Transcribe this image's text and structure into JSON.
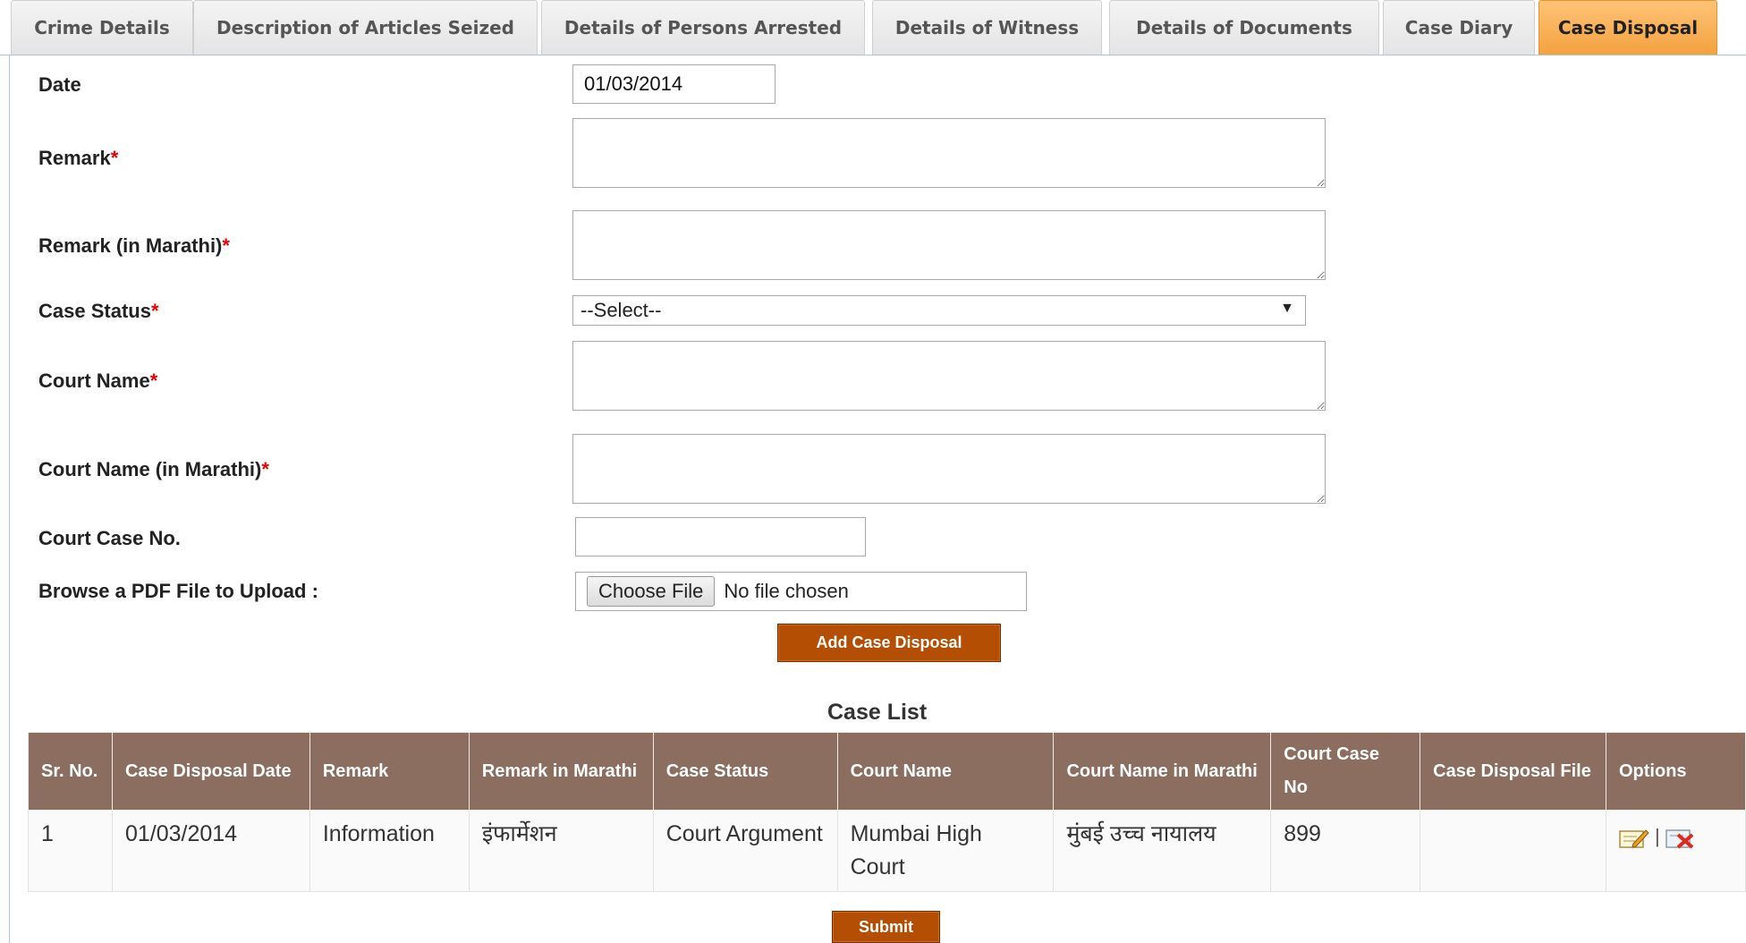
{
  "tabs": [
    {
      "label": "Crime Details",
      "active": false
    },
    {
      "label": "Description of Articles Seized",
      "active": false
    },
    {
      "label": "Details of Persons Arrested",
      "active": false
    },
    {
      "label": "Details of Witness",
      "active": false
    },
    {
      "label": "Details of Documents",
      "active": false
    },
    {
      "label": "Case Diary",
      "active": false
    },
    {
      "label": "Case Disposal",
      "active": true
    }
  ],
  "form": {
    "date_label": "Date",
    "date_value": "01/03/2014",
    "remark_label": "Remark",
    "remark_marathi_label": "Remark (in Marathi)",
    "case_status_label": "Case Status",
    "case_status_selected": "--Select--",
    "court_name_label": "Court Name",
    "court_name_marathi_label": "Court Name (in Marathi)",
    "court_case_no_label": "Court Case No.",
    "court_case_no_value": "",
    "browse_pdf_label": "Browse a PDF File to Upload :",
    "choose_file_label": "Choose File",
    "no_file_text": "No file chosen",
    "required_mark": "*",
    "add_button_label": "Add Case Disposal"
  },
  "case_list": {
    "title": "Case List",
    "headers": [
      "Sr. No.",
      "Case Disposal Date",
      "Remark",
      "Remark in Marathi",
      "Case Status",
      "Court Name",
      "Court Name in Marathi",
      "Court Case No",
      "Case Disposal File",
      "Options"
    ],
    "rows": [
      {
        "sr_no": "1",
        "date": "01/03/2014",
        "remark": "Information",
        "remark_marathi": "इंफार्मेशन",
        "case_status": "Court Argument",
        "court_name": "Mumbai High Court",
        "court_name_marathi": "मुंबई उच्च नायालय",
        "court_case_no": "899",
        "file": "",
        "options_separator": "|"
      }
    ]
  },
  "submit_label": "Submit",
  "colors": {
    "active_tab": "#f3a23f",
    "table_header": "#8b6e60",
    "button": "#b34e02",
    "required": "#ee0000"
  },
  "icons": [
    "edit-icon",
    "delete-icon",
    "dropdown-arrow-icon"
  ]
}
